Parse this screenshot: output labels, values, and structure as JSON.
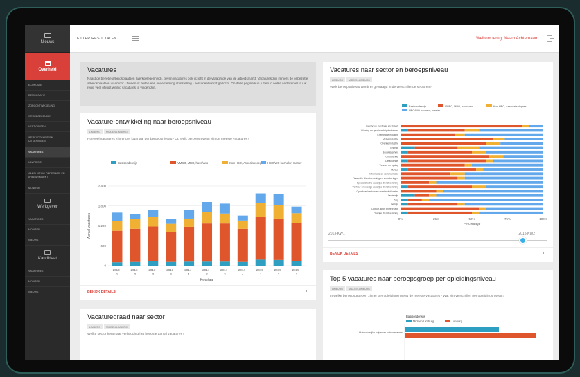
{
  "sidebar": {
    "top_item": "Nieuws",
    "active_section": "Overheid",
    "overheid_items": [
      {
        "label": "Economie"
      },
      {
        "label": "Demografie"
      },
      {
        "label": "Zorgontwikkeling"
      },
      {
        "label": "Werkzoekenden"
      },
      {
        "label": "Vestigingen"
      },
      {
        "label": "Werkloosheid en uitkeringen"
      },
      {
        "label": "Vacatures"
      },
      {
        "label": "Vakcrisis"
      },
      {
        "label": "Aansluiting onderwijs en arbeidsmarkt"
      },
      {
        "label": "Monitor"
      }
    ],
    "werkgever_label": "Werkgever",
    "werkgever_items": [
      {
        "label": "Vacatures"
      },
      {
        "label": "Monitor"
      },
      {
        "label": "Nieuws"
      }
    ],
    "kandidaat_label": "Kandidaat",
    "kandidaat_items": [
      {
        "label": "Vacatures"
      },
      {
        "label": "Monitor"
      },
      {
        "label": "Nieuws"
      }
    ]
  },
  "header": {
    "filter_label": "FILTER RESULTATEN",
    "user_text": "Welkom terug, Naam Achternaam"
  },
  "intro": {
    "title": "Vacatures",
    "text": "Naast de bezette arbeidsplaatsen (werkgelegenheid), geven vacatures ook inzicht in de vraagzijde van de arbeidsmarkt. Vacatures zijn immers de onbezette arbeidsplaatsen waarvoor - binnen of buiten een onderneming of instelling - personeel wordt gezocht. Op deze pagina kun u zien in welke sectoren er in uw regio veel of juist weinig vacatures te vinden zijn."
  },
  "card_ontwikkeling": {
    "title": "Vacature-ontwikkeling naar beroepsniveau",
    "tags": [
      "Limburg",
      "Midden-Limburg"
    ],
    "subtitle": "Hoeveel vacatures zijn er per kwartaal per beroepsniveau? Op welk beroepsniveau zijn de meeste vacatures?",
    "details": "BEKIJK DETAILS"
  },
  "card_sector": {
    "title": "Vacaturegraad naar sector",
    "tags": [
      "Limburg",
      "Midden-Limburg"
    ],
    "subtitle": "Welke sector kent naar verhouding het hoogste aantal vacatures?"
  },
  "card_sector_niveau": {
    "title": "Vacatures naar sector en beroepsniveau",
    "tags": [
      "Limburg",
      "Midden-Limburg"
    ],
    "subtitle": "Welk beroepsniveau wordt er gevraagd in de verschillende sectoren?",
    "slider_left": "2013-KW1",
    "slider_right": "2015-KW2",
    "details": "BEKIJK DETAILS"
  },
  "card_top5": {
    "title": "Top 5 vacatures naar beroepsgroep per opleidingsniveau",
    "tags": [
      "Limburg",
      "Midden-Limburg"
    ],
    "subtitle": "In welke beroepsgroepen zijn er per opleidingsniveau de meeste vacatures? Wat zijn verschillen per opleidingsniveau?"
  },
  "colors": {
    "basis": "#2e9fc1",
    "vmbo": "#e0562c",
    "mbo": "#f0b033",
    "hbo": "#63a8ea",
    "accent": "#d9403a"
  },
  "chart_data": [
    {
      "type": "bar",
      "stacked": true,
      "categories": [
        "2013 - 1",
        "2013 - 2",
        "2013 - 3",
        "2013 - 4",
        "2014 - 1",
        "2014 - 2",
        "2014 - 3",
        "2014 - 4",
        "2015 - 1",
        "2015 - 2",
        "2015 - 3"
      ],
      "series": [
        {
          "name": "Basisonderwijs",
          "values": [
            100,
            110,
            130,
            110,
            120,
            120,
            120,
            110,
            180,
            170,
            130
          ]
        },
        {
          "name": "VMBO, MBO, havo/vwo",
          "values": [
            950,
            1000,
            1050,
            900,
            1050,
            1150,
            1150,
            1000,
            1300,
            1250,
            1150
          ]
        },
        {
          "name": "Kort HBO, Associate degree",
          "values": [
            300,
            300,
            300,
            250,
            250,
            350,
            300,
            250,
            400,
            400,
            300
          ]
        },
        {
          "name": "HBO/WO bachelor, master",
          "values": [
            250,
            150,
            200,
            150,
            250,
            300,
            300,
            150,
            300,
            350,
            200
          ]
        }
      ],
      "xlabel": "Kwartaal",
      "ylabel": "Aantal vacatures",
      "ylim": [
        0,
        2400
      ],
      "yticks": [
        "0",
        "600",
        "1.200",
        "1.800",
        "2.400"
      ],
      "legend": "top"
    },
    {
      "type": "bar",
      "orientation": "horizontal",
      "stacked_percent": true,
      "categories": [
        "Landbouw, bosbouw en visserij",
        "Winning en gevolmachtigdenbeheer",
        "Chemische industrie",
        "Metaalindustrie",
        "Overige industrie",
        "Energie",
        "Bouwnijverheid",
        "Groothandel",
        "Detailhandel",
        "Vervoer en opslag",
        "Horeca",
        "Informatie en communicatie",
        "Financiële dienstverlening en verzekeringen",
        "Specialistische zakelijke dienstverlening",
        "Verhuur en overige zakelijke dienstverlening",
        "Openbaar bestuur en overheidsdiensten",
        "Onderwijs",
        "Zorg",
        "Welzijn",
        "Cultuur, sport en recreatie",
        "Overige dienstverlening"
      ],
      "series": [
        {
          "name": "Basisonderwijs",
          "values": [
            0,
            5,
            0,
            0,
            0,
            10,
            5,
            0,
            5,
            0,
            5,
            0,
            0,
            0,
            5,
            0,
            10,
            5,
            5,
            0,
            5
          ]
        },
        {
          "name": "VMBO, MBO, havo/vwo",
          "values": [
            85,
            40,
            38,
            65,
            60,
            30,
            45,
            62,
            55,
            45,
            48,
            35,
            40,
            20,
            45,
            25,
            10,
            10,
            35,
            55,
            45
          ]
        },
        {
          "name": "Kort HBO, Associate degree",
          "values": [
            5,
            10,
            7,
            8,
            10,
            15,
            10,
            10,
            5,
            5,
            5,
            10,
            5,
            5,
            10,
            5,
            5,
            5,
            5,
            5,
            5
          ]
        },
        {
          "name": "HBO/WO bachelor, master",
          "values": [
            10,
            45,
            55,
            27,
            30,
            45,
            40,
            28,
            35,
            50,
            42,
            55,
            55,
            75,
            40,
            70,
            75,
            80,
            55,
            40,
            45
          ]
        }
      ],
      "xlabel": "Percentage",
      "xticks": [
        "0%",
        "25%",
        "50%",
        "75%",
        "100%"
      ],
      "xlim": [
        0,
        100
      ],
      "legend": "top"
    },
    {
      "type": "bar",
      "orientation": "horizontal",
      "legend_title": "Basisonderwijs",
      "series": [
        {
          "name": "Midden-Limburg",
          "values": [
            68
          ]
        },
        {
          "name": "Limburg",
          "values": [
            95
          ]
        }
      ],
      "categories": [
        "Huishoudelijke hulpen en schoonmakers"
      ],
      "xlim": [
        0,
        100
      ]
    }
  ]
}
